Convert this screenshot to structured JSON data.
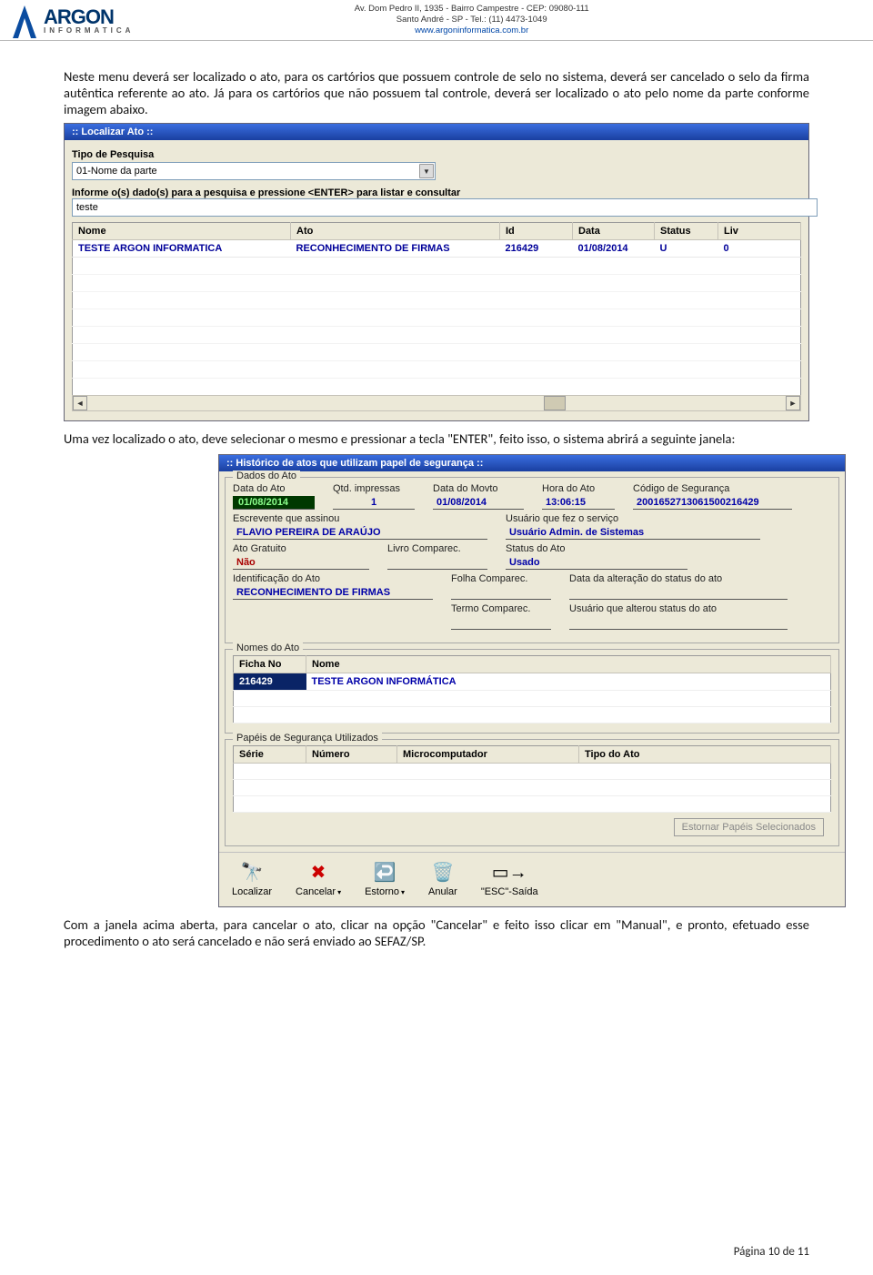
{
  "header": {
    "logo_title": "ARGON",
    "logo_sub": "INFORMATICA",
    "address_l1": "Av. Dom Pedro II, 1935 - Bairro Campestre - CEP: 09080-111",
    "address_l2": "Santo André - SP - Tel.: (11) 4473-1049",
    "site": "www.argoninformatica.com.br"
  },
  "paragraphs": {
    "p1": "Neste menu deverá ser localizado o ato, para os cartórios que possuem controle de selo no sistema, deverá ser cancelado o selo da firma autêntica referente ao ato. Já para os cartórios que não possuem tal controle, deverá ser localizado o ato pelo nome da parte conforme imagem abaixo.",
    "p2": "Uma vez localizado o ato, deve selecionar o mesmo e pressionar a tecla \"ENTER\", feito isso, o sistema abrirá a seguinte janela:",
    "p3": "Com a janela acima aberta, para cancelar o ato, clicar na opção \"Cancelar\" e feito isso clicar em \"Manual\", e pronto, efetuado esse procedimento o ato será cancelado e não será enviado ao SEFAZ/SP."
  },
  "localizar": {
    "title": ":: Localizar Ato ::",
    "tipo_label": "Tipo de Pesquisa",
    "tipo_value": "01-Nome da parte",
    "info_label": "Informe o(s) dado(s) para a pesquisa e pressione <ENTER> para listar e consultar",
    "input_value": "teste",
    "cols": {
      "nome": "Nome",
      "ato": "Ato",
      "id": "Id",
      "data": "Data",
      "status": "Status",
      "livro": "Liv"
    },
    "row": {
      "nome": "TESTE ARGON INFORMATICA",
      "ato": "RECONHECIMENTO DE FIRMAS",
      "id": "216429",
      "data": "01/08/2014",
      "status": "U",
      "livro": "0"
    }
  },
  "historico": {
    "title": ":: Histórico de atos que utilizam papel de segurança ::",
    "legend_dados": "Dados do Ato",
    "dados": {
      "data_ato_l": "Data do Ato",
      "data_ato_v": "01/08/2014",
      "qtd_l": "Qtd. impressas",
      "qtd_v": "1",
      "data_movto_l": "Data do Movto",
      "data_movto_v": "01/08/2014",
      "hora_l": "Hora do Ato",
      "hora_v": "13:06:15",
      "cod_l": "Código de Segurança",
      "cod_v": "20016527130615002164​29",
      "escrevente_l": "Escrevente que assinou",
      "escrevente_v": "FLAVIO PEREIRA DE ARAÚJO",
      "usuario_serv_l": "Usuário que fez o serviço",
      "usuario_serv_v": "Usuário Admin. de Sistemas",
      "ato_grat_l": "Ato Gratuito",
      "ato_grat_v": "Não",
      "livro_comp_l": "Livro Comparec.",
      "livro_comp_v": "",
      "status_ato_l": "Status do Ato",
      "status_ato_v": "Usado",
      "ident_ato_l": "Identificação do Ato",
      "ident_ato_v": "RECONHECIMENTO DE FIRMAS",
      "folha_comp_l": "Folha Comparec.",
      "folha_comp_v": "",
      "data_alt_l": "Data da alteração do status do ato",
      "data_alt_v": "",
      "termo_comp_l": "Termo Comparec.",
      "termo_comp_v": "",
      "usuario_alt_l": "Usuário que alterou status do ato",
      "usuario_alt_v": ""
    },
    "nomes_legend": "Nomes do Ato",
    "nomes_cols": {
      "ficha": "Ficha No",
      "nome": "Nome"
    },
    "nomes_row": {
      "ficha": "216429",
      "nome": "TESTE ARGON INFORMÁTICA"
    },
    "papeis_legend": "Papéis de Segurança Utilizados",
    "papeis_cols": {
      "serie": "Série",
      "numero": "Número",
      "micro": "Microcomputador",
      "tipo": "Tipo do Ato"
    },
    "btn_estornar": "Estornar Papéis Selecionados",
    "toolbar": {
      "localizar": "Localizar",
      "cancelar": "Cancelar",
      "estorno": "Estorno",
      "anular": "Anular",
      "esc": "\"ESC\"-Saída"
    }
  },
  "footer": {
    "page": "Página 10 de 11"
  }
}
